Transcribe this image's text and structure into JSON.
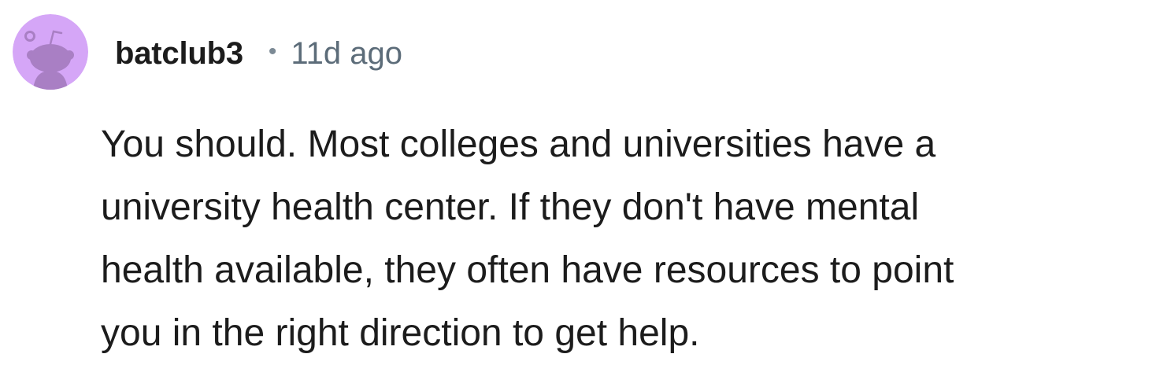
{
  "comment": {
    "author": "batclub3",
    "separator": "•",
    "age": "11d ago",
    "avatar_icon": "snoo-avatar-icon",
    "avatar_color": "#d5a6f7",
    "body_lines": [
      "You should. Most colleges and universities have a",
      "university health center. If they don't have mental",
      "health available, they often have resources to point",
      "you in the right direction to get help."
    ]
  }
}
